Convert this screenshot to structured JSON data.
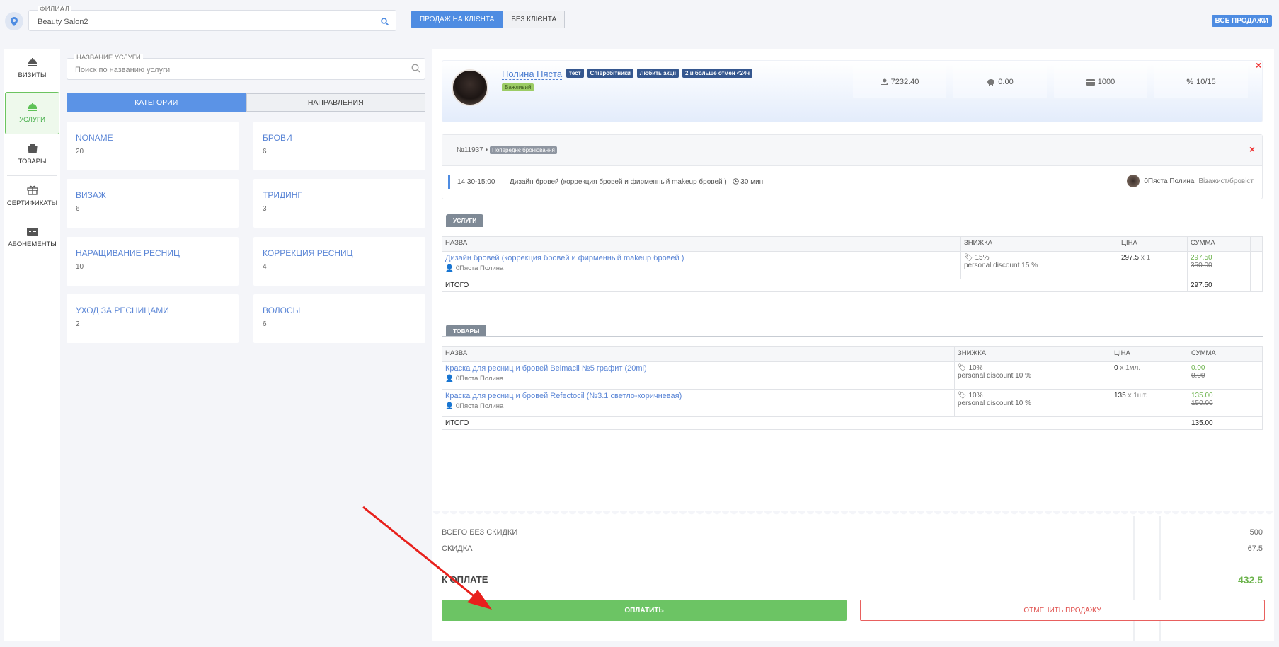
{
  "topbar": {
    "branch_label": "ФИЛИАЛ",
    "branch_value": "Beauty Salon2",
    "mode_client": "ПРОДАЖ НА КЛІЄНТА",
    "mode_no_client": "БЕЗ КЛІЄНТА",
    "all_sales": "ВСЕ ПРОДАЖИ"
  },
  "nav": {
    "items": [
      {
        "label": "ВИЗИТЫ",
        "icon": "bell-icon"
      },
      {
        "label": "УСЛУГИ",
        "icon": "service-icon",
        "active": true
      },
      {
        "label": "ТОВАРЫ",
        "icon": "bag-icon"
      },
      {
        "label": "СЕРТИФИКАТЫ",
        "icon": "gift-icon"
      },
      {
        "label": "АБОНЕМЕНТЫ",
        "icon": "card-icon"
      }
    ]
  },
  "services": {
    "search_label": "НАЗВАНИЕ УСЛУГИ",
    "search_placeholder": "Поиск по названию услуги",
    "tabs": [
      "КАТЕГОРИИ",
      "НАПРАВЛЕНИЯ"
    ],
    "categories": [
      {
        "name": "NONAME",
        "count": "20"
      },
      {
        "name": "БРОВИ",
        "count": "6"
      },
      {
        "name": "ВИЗАЖ",
        "count": "6"
      },
      {
        "name": "ТРИДИНГ",
        "count": "3"
      },
      {
        "name": "НАРАЩИВАНИЕ РЕСНИЦ",
        "count": "10"
      },
      {
        "name": "КОРРЕКЦИЯ РЕСНИЦ",
        "count": "4"
      },
      {
        "name": "УХОД ЗА РЕСНИЦАМИ",
        "count": "2"
      },
      {
        "name": "ВОЛОСЫ",
        "count": "6"
      }
    ]
  },
  "client": {
    "name": "Полина Пяста",
    "tags": [
      "тест",
      "Співробітники",
      "Любить акції",
      "2 и больше отмен <24ч"
    ],
    "badge": "Важливий",
    "stats": [
      "7232.40",
      "0.00",
      "1000",
      "10/15"
    ]
  },
  "booking": {
    "number": "№11937 •",
    "status": "Попереднє бронювання",
    "time": "14:30-15:00",
    "service": "Дизайн бровей (коррекция бровей и фирменный makeup бровей )",
    "duration": "30 мин",
    "staff_name": "0Пяста Полина",
    "staff_role": "Візажист/бровіст"
  },
  "services_table": {
    "section": "УСЛУГИ",
    "headers": [
      "НАЗВА",
      "ЗНИЖКА",
      "ЦІНА",
      "СУММА"
    ],
    "rows": [
      {
        "name": "Дизайн бровей (коррекция бровей и фирменный makeup бровей )",
        "staff": "0Пяста Полина",
        "discount": "15%",
        "discount_note": "personal discount 15 %",
        "price": "297.5",
        "qty": "x 1",
        "sum": "297.50",
        "sum_old": "350.00"
      }
    ],
    "total_label": "ИТОГО",
    "total": "297.50"
  },
  "goods_table": {
    "section": "ТОВАРЫ",
    "headers": [
      "НАЗВА",
      "ЗНИЖКА",
      "ЦІНА",
      "СУММА"
    ],
    "rows": [
      {
        "name": "Краска для ресниц и бровей Belmacil №5 графит (20ml)",
        "staff": "0Пяста Полина",
        "discount": "10%",
        "discount_note": "personal discount 10 %",
        "price": "0",
        "qty": "x 1мл.",
        "sum": "0.00",
        "sum_old": "0.00"
      },
      {
        "name": "Краска для ресниц и бровей Refectocil (№3.1 светло-коричневая)",
        "staff": "0Пяста Полина",
        "discount": "10%",
        "discount_note": "personal discount 10 %",
        "price": "135",
        "qty": "x 1шт.",
        "sum": "135.00",
        "sum_old": "150.00"
      }
    ],
    "total_label": "ИТОГО",
    "total": "135.00"
  },
  "summary": {
    "no_discount_label": "ВСЕГО БЕЗ СКИДКИ",
    "no_discount": "500",
    "discount_label": "СКИДКА",
    "discount": "67.5",
    "to_pay_label": "К ОПЛАТЕ",
    "to_pay": "432.5",
    "pay_button": "ОПЛАТИТЬ",
    "cancel_button": "ОТМЕНИТЬ ПРОДАЖУ"
  },
  "colors": {
    "accent": "#4e8ce2",
    "success": "#6cc464",
    "danger": "#e0504d",
    "annotation_arrow": "#e8201c"
  }
}
